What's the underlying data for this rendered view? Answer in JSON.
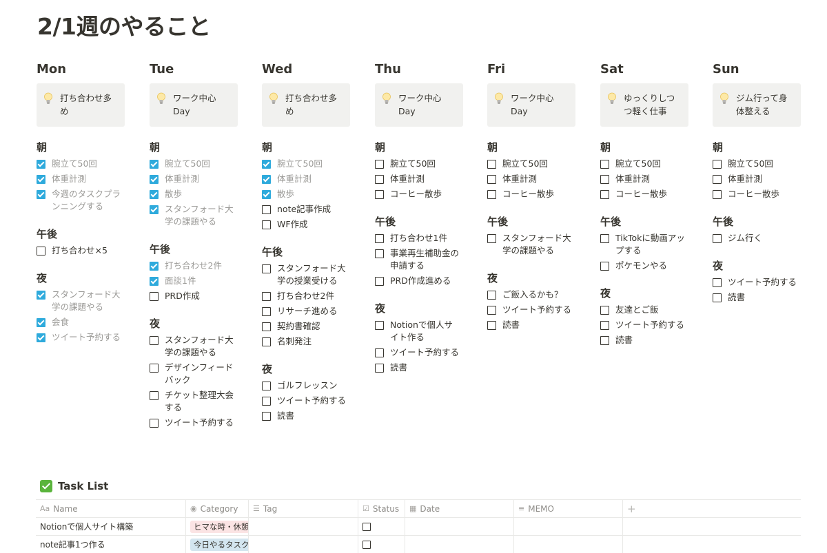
{
  "title": "2/1週のやること",
  "days": [
    {
      "name": "Mon",
      "callout": [
        "打ち合わせ多",
        "め"
      ],
      "sections": [
        {
          "head": "朝",
          "items": [
            {
              "text": [
                "腕立て50回"
              ],
              "done": true
            },
            {
              "text": [
                "体重計測"
              ],
              "done": true
            },
            {
              "text": [
                "今週のタスクプラ",
                "ンニングする"
              ],
              "done": true
            }
          ]
        },
        {
          "head": "午後",
          "items": [
            {
              "text": [
                "打ち合わせ×5"
              ],
              "done": false
            }
          ]
        },
        {
          "head": "夜",
          "items": [
            {
              "text": [
                "スタンフォード大",
                "学の課題やる"
              ],
              "done": true
            },
            {
              "text": [
                "会食"
              ],
              "done": true
            },
            {
              "text": [
                "ツイート予約する"
              ],
              "done": true
            }
          ]
        }
      ]
    },
    {
      "name": "Tue",
      "callout": [
        "ワーク中心",
        "Day"
      ],
      "sections": [
        {
          "head": "朝",
          "items": [
            {
              "text": [
                "腕立て50回"
              ],
              "done": true
            },
            {
              "text": [
                "体重計測"
              ],
              "done": true
            },
            {
              "text": [
                "散歩"
              ],
              "done": true
            },
            {
              "text": [
                "スタンフォード大",
                "学の課題やる"
              ],
              "done": true
            }
          ]
        },
        {
          "head": "午後",
          "items": [
            {
              "text": [
                "打ち合わせ2件"
              ],
              "done": true
            },
            {
              "text": [
                "面談1件"
              ],
              "done": true
            },
            {
              "text": [
                "PRD作成"
              ],
              "done": false
            }
          ]
        },
        {
          "head": "夜",
          "items": [
            {
              "text": [
                "スタンフォード大",
                "学の課題やる"
              ],
              "done": false
            },
            {
              "text": [
                "デザインフィード",
                "バック"
              ],
              "done": false
            },
            {
              "text": [
                "チケット整理大会",
                "する"
              ],
              "done": false
            },
            {
              "text": [
                "ツイート予約する"
              ],
              "done": false
            }
          ]
        }
      ]
    },
    {
      "name": "Wed",
      "callout": [
        "打ち合わせ多",
        "め"
      ],
      "sections": [
        {
          "head": "朝",
          "items": [
            {
              "text": [
                "腕立て50回"
              ],
              "done": true
            },
            {
              "text": [
                "体重計測"
              ],
              "done": true
            },
            {
              "text": [
                "散歩"
              ],
              "done": true
            },
            {
              "text": [
                "note記事作成"
              ],
              "done": false
            },
            {
              "text": [
                "WF作成"
              ],
              "done": false
            }
          ]
        },
        {
          "head": "午後",
          "items": [
            {
              "text": [
                "スタンフォード大",
                "学の授業受ける"
              ],
              "done": false
            },
            {
              "text": [
                "打ち合わせ2件"
              ],
              "done": false
            },
            {
              "text": [
                "リサーチ進める"
              ],
              "done": false
            },
            {
              "text": [
                "契約書確認"
              ],
              "done": false
            },
            {
              "text": [
                "名刺発注"
              ],
              "done": false
            }
          ]
        },
        {
          "head": "夜",
          "items": [
            {
              "text": [
                "ゴルフレッスン"
              ],
              "done": false
            },
            {
              "text": [
                "ツイート予約する"
              ],
              "done": false
            },
            {
              "text": [
                "読書"
              ],
              "done": false
            }
          ]
        }
      ]
    },
    {
      "name": "Thu",
      "callout": [
        "ワーク中心",
        "Day"
      ],
      "sections": [
        {
          "head": "朝",
          "items": [
            {
              "text": [
                "腕立て50回"
              ],
              "done": false
            },
            {
              "text": [
                "体重計測"
              ],
              "done": false
            },
            {
              "text": [
                "コーヒー散歩"
              ],
              "done": false
            }
          ]
        },
        {
          "head": "午後",
          "items": [
            {
              "text": [
                "打ち合わせ1件"
              ],
              "done": false
            },
            {
              "text": [
                "事業再生補助金の",
                "申請する"
              ],
              "done": false
            },
            {
              "text": [
                "PRD作成進める"
              ],
              "done": false
            }
          ]
        },
        {
          "head": "夜",
          "items": [
            {
              "text": [
                "Notionで個人サ",
                "イト作る"
              ],
              "done": false
            },
            {
              "text": [
                "ツイート予約する"
              ],
              "done": false
            },
            {
              "text": [
                "読書"
              ],
              "done": false
            }
          ]
        }
      ]
    },
    {
      "name": "Fri",
      "callout": [
        "ワーク中心",
        "Day"
      ],
      "sections": [
        {
          "head": "朝",
          "items": [
            {
              "text": [
                "腕立て50回"
              ],
              "done": false
            },
            {
              "text": [
                "体重計測"
              ],
              "done": false
            },
            {
              "text": [
                "コーヒー散歩"
              ],
              "done": false
            }
          ]
        },
        {
          "head": "午後",
          "items": [
            {
              "text": [
                "スタンフォード大",
                "学の課題やる"
              ],
              "done": false
            }
          ]
        },
        {
          "head": "夜",
          "items": [
            {
              "text": [
                "ご飯入るかも？"
              ],
              "done": false
            },
            {
              "text": [
                "ツイート予約する"
              ],
              "done": false
            },
            {
              "text": [
                "読書"
              ],
              "done": false
            }
          ]
        }
      ]
    },
    {
      "name": "Sat",
      "callout": [
        "ゆっくりしつ",
        "つ軽く仕事"
      ],
      "sections": [
        {
          "head": "朝",
          "items": [
            {
              "text": [
                "腕立て50回"
              ],
              "done": false
            },
            {
              "text": [
                "体重計測"
              ],
              "done": false
            },
            {
              "text": [
                "コーヒー散歩"
              ],
              "done": false
            }
          ]
        },
        {
          "head": "午後",
          "items": [
            {
              "text": [
                "TikTokに動画アッ",
                "プする"
              ],
              "done": false
            },
            {
              "text": [
                "ポケモンやる"
              ],
              "done": false
            }
          ]
        },
        {
          "head": "夜",
          "items": [
            {
              "text": [
                "友達とご飯"
              ],
              "done": false
            },
            {
              "text": [
                "ツイート予約する"
              ],
              "done": false
            },
            {
              "text": [
                "読書"
              ],
              "done": false
            }
          ]
        }
      ]
    },
    {
      "name": "Sun",
      "callout": [
        "ジム行って身",
        "体整える"
      ],
      "sections": [
        {
          "head": "朝",
          "items": [
            {
              "text": [
                "腕立て50回"
              ],
              "done": false
            },
            {
              "text": [
                "体重計測"
              ],
              "done": false
            },
            {
              "text": [
                "コーヒー散歩"
              ],
              "done": false
            }
          ]
        },
        {
          "head": "午後",
          "items": [
            {
              "text": [
                "ジム行く"
              ],
              "done": false
            }
          ]
        },
        {
          "head": "夜",
          "items": [
            {
              "text": [
                "ツイート予約する"
              ],
              "done": false
            },
            {
              "text": [
                "読書"
              ],
              "done": false
            }
          ]
        }
      ]
    }
  ],
  "task_list": {
    "title": "Task List",
    "columns": {
      "name": "Name",
      "category": "Category",
      "tag": "Tag",
      "status": "Status",
      "date": "Date",
      "memo": "MEMO",
      "add": "+"
    },
    "column_icons": {
      "name": "Aa",
      "category": "◉",
      "tag": "☰",
      "status": "☑",
      "date": "▦",
      "memo": "≡"
    },
    "rows": [
      {
        "name": "Notionで個人サイト構築",
        "category": "ヒマな時・休憩",
        "category_color": "#fbe4e4"
      },
      {
        "name": "note記事1つ作る",
        "category": "今日やるタスク",
        "category_color": "#d3e5ef"
      }
    ]
  },
  "colors": {
    "checked": "#2eaadc",
    "callout_bg": "#f1f1ef",
    "text": "#37352f",
    "muted": "#9b9a97"
  }
}
